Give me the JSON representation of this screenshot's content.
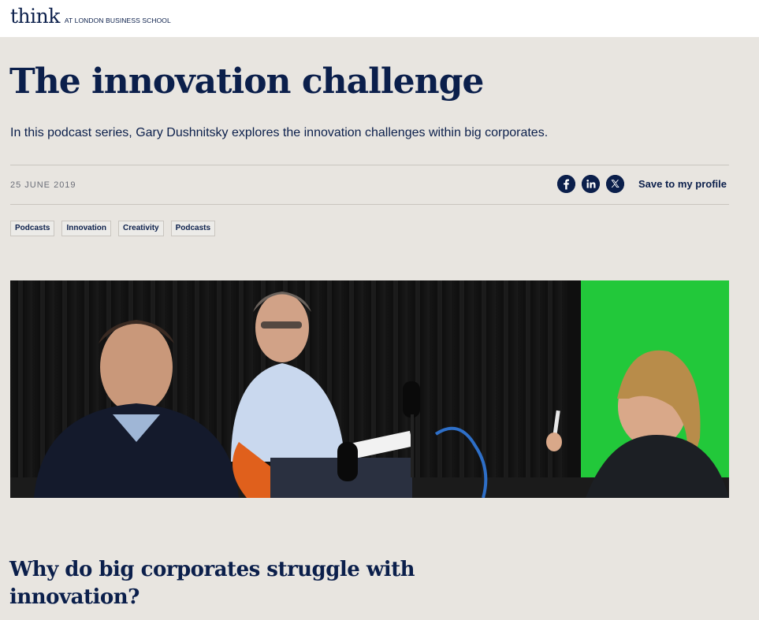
{
  "header": {
    "logo_word": "think",
    "logo_sub": "AT LONDON BUSINESS SCHOOL"
  },
  "article": {
    "title": "The innovation challenge",
    "standfirst": "In this podcast series, Gary Dushnitsky explores the innovation challenges within big corporates.",
    "date": "25 JUNE 2019",
    "save_label": "Save to my profile",
    "share_icons": [
      "facebook-icon",
      "linkedin-icon",
      "x-icon"
    ],
    "tags": [
      "Podcasts",
      "Innovation",
      "Creativity",
      "Podcasts"
    ],
    "section_heading": "Why do big corporates struggle with innovation?"
  },
  "colors": {
    "navy": "#0b1f4b",
    "page_bg": "#e8e5e0",
    "green_screen": "#22c83a"
  }
}
